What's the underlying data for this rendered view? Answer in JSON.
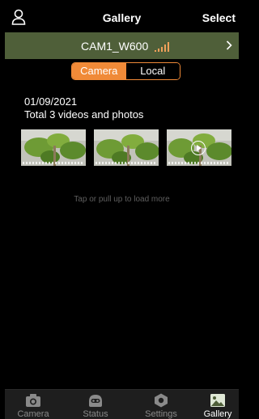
{
  "header": {
    "title": "Gallery",
    "select_label": "Select",
    "user_icon": "user-icon"
  },
  "camera_bar": {
    "name": "CAM1_W600",
    "signal_icon": "signal-bars-icon",
    "chevron_icon": "chevron-right-icon",
    "background": "#4f5f39"
  },
  "segment": {
    "options": [
      "Camera",
      "Local"
    ],
    "selected": "Camera",
    "accent": "#f08a38"
  },
  "gallery": {
    "date": "01/09/2021",
    "summary": "Total 3 videos and photos",
    "items": [
      {
        "type": "photo"
      },
      {
        "type": "photo"
      },
      {
        "type": "video"
      }
    ],
    "load_more": "Tap or pull up to load more"
  },
  "tabbar": {
    "tabs": [
      {
        "label": "Camera",
        "icon": "camera-icon"
      },
      {
        "label": "Status",
        "icon": "robot-face-icon"
      },
      {
        "label": "Settings",
        "icon": "settings-hex-icon"
      },
      {
        "label": "Gallery",
        "icon": "gallery-image-icon",
        "active": true
      }
    ]
  }
}
